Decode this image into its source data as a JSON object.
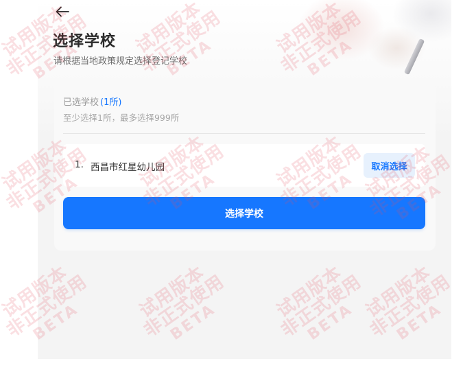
{
  "header": {
    "title": "选择学校",
    "subtitle": "请根据当地政策规定选择登记学校"
  },
  "selection": {
    "selected_label": "已选学校",
    "selected_count": "(1所)",
    "rule": "至少选择1所，最多选择999所"
  },
  "schools": [
    {
      "index": "1.",
      "name": "西昌市红星幼儿园",
      "action_label": "取消选择"
    }
  ],
  "primary_button": {
    "label": "选择学校"
  },
  "watermark": {
    "line1": "试用版本",
    "line2": "非正式使用",
    "line3": "BETA"
  },
  "colors": {
    "accent": "#1677ff",
    "accent_light": "#e7f1fd",
    "watermark": "#e4505f"
  }
}
